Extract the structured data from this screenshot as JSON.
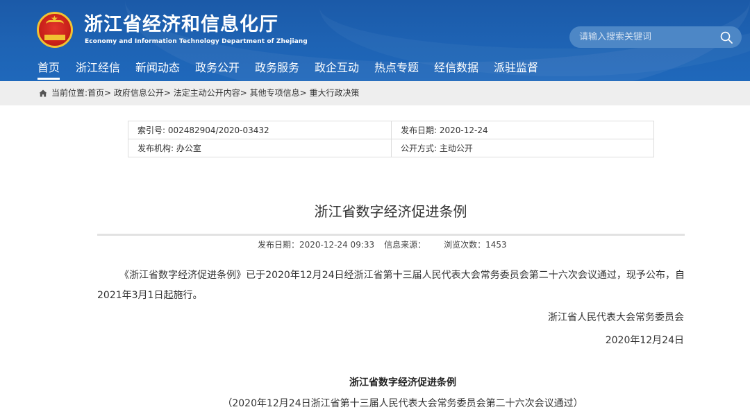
{
  "header": {
    "title": "浙江省经济和信息化厅",
    "subtitle": "Economy and Information Technology Department of Zhejiang",
    "search": {
      "placeholder": "请输入搜索关键词"
    }
  },
  "nav": {
    "items": [
      {
        "label": "首页",
        "active": true
      },
      {
        "label": "浙江经信"
      },
      {
        "label": "新闻动态"
      },
      {
        "label": "政务公开"
      },
      {
        "label": "政务服务"
      },
      {
        "label": "政企互动"
      },
      {
        "label": "热点专题"
      },
      {
        "label": "经信数据"
      },
      {
        "label": "派驻监督"
      }
    ]
  },
  "breadcrumb": {
    "text": "当前位置:首页> 政府信息公开> 法定主动公开内容> 其他专项信息> 重大行政决策"
  },
  "meta": {
    "index_no": "索引号: 002482904/2020-03432",
    "publish_date": "发布日期: 2020-12-24",
    "publisher": "发布机构: 办公室",
    "open_mode": "公开方式: 主动公开"
  },
  "article": {
    "title": "浙江省数字经济促进条例",
    "publish_time": "发布日期：2020-12-24 09:33",
    "source": "信息来源：",
    "views": "浏览次数：1453",
    "paragraph": "《浙江省数字经济促进条例》已于2020年12月24日经浙江省第十三届人民代表大会常务委员会第二十六次会议通过，现予公布，自2021年3月1日起施行。",
    "sign_org": "浙江省人民代表大会常务委员会",
    "sign_date": "2020年12月24日",
    "law_title": "浙江省数字经济促进条例",
    "law_note": "（2020年12月24日浙江省第十三届人民代表大会常务委员会第二十六次会议通过）"
  },
  "colors": {
    "header_blue": "#1e63b4",
    "breadcrumb_bg": "#eeeeee",
    "emblem_red": "#c9211a",
    "emblem_gold": "#f1c232"
  }
}
